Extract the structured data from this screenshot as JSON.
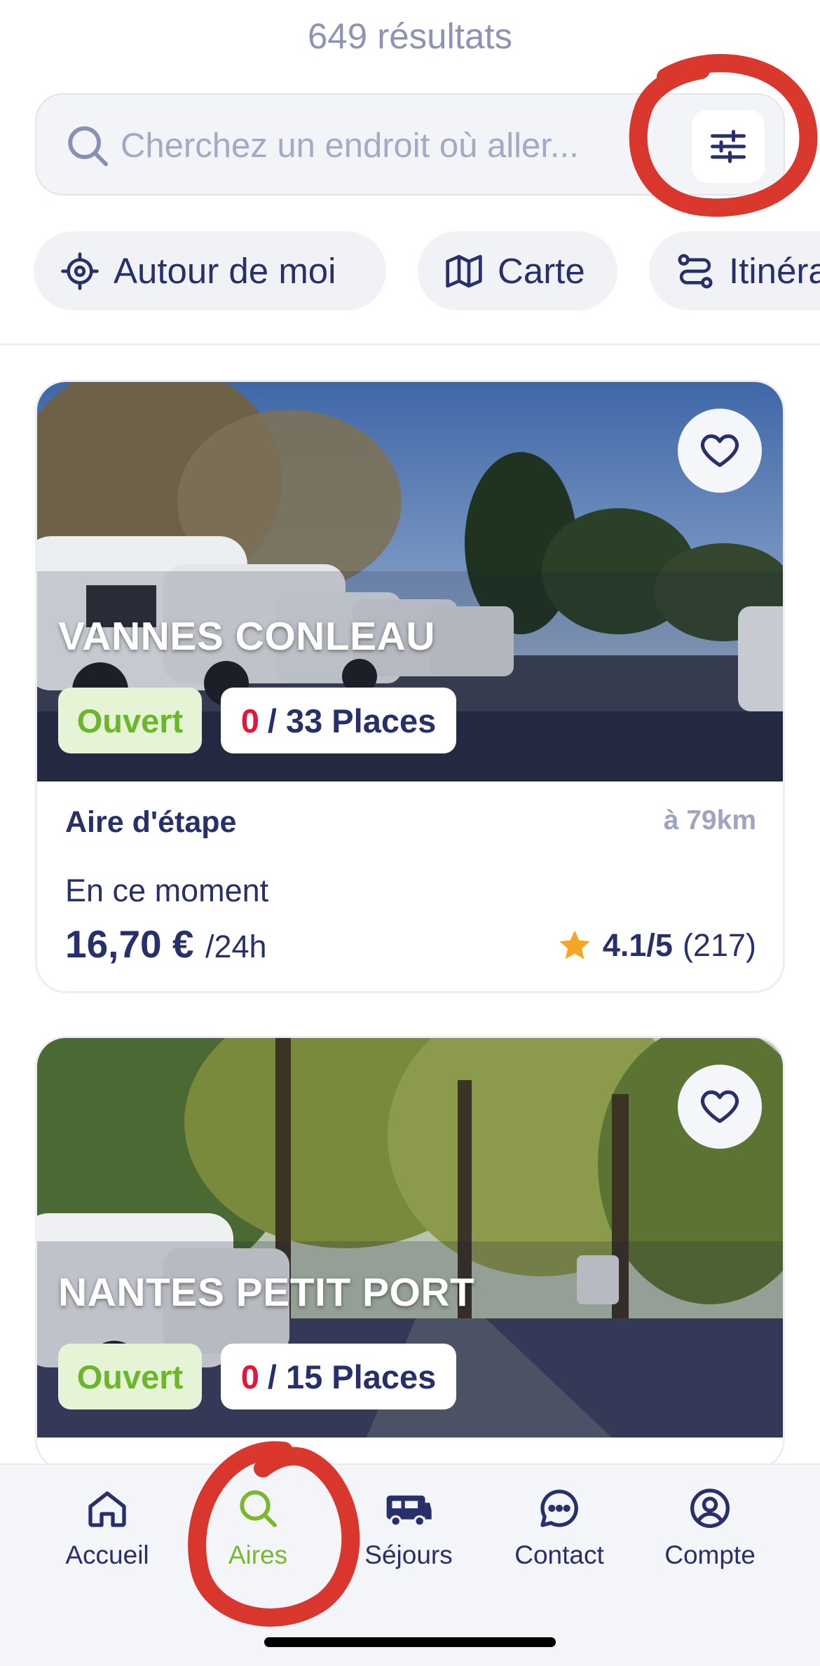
{
  "results_count": "649 résultats",
  "search": {
    "placeholder": "Cherchez un endroit où aller..."
  },
  "chips": [
    {
      "label": "Autour de moi",
      "icon": "crosshair-icon"
    },
    {
      "label": "Carte",
      "icon": "map-icon"
    },
    {
      "label": "Itinéraire",
      "icon": "route-icon"
    }
  ],
  "listings": [
    {
      "name": "VANNES CONLEAU",
      "status": "Ouvert",
      "places_free": "0",
      "places_total": "/ 33 Places",
      "type": "Aire d'étape",
      "distance": "à 79km",
      "moment_label": "En ce moment",
      "price": "16,70 €",
      "price_unit": "/24h",
      "rating": "4.1/5",
      "reviews": "(217)"
    },
    {
      "name": "NANTES PETIT PORT",
      "status": "Ouvert",
      "places_free": "0",
      "places_total": "/ 15 Places"
    }
  ],
  "nav": [
    {
      "label": "Accueil",
      "icon": "home-icon"
    },
    {
      "label": "Aires",
      "icon": "search-icon",
      "active": true
    },
    {
      "label": "Séjours",
      "icon": "camper-van-icon"
    },
    {
      "label": "Contact",
      "icon": "chat-icon"
    },
    {
      "label": "Compte",
      "icon": "account-icon"
    }
  ],
  "colors": {
    "primary": "#27306b",
    "accent_green": "#7ab82c",
    "open_badge_bg": "#e6f4d6",
    "full_red": "#e2163a",
    "annotation_red": "#d7261b",
    "star": "#f5a623"
  }
}
